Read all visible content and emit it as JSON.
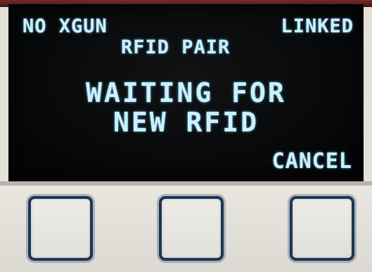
{
  "screen": {
    "status_left": "NO XGUN",
    "status_right": "LINKED",
    "mode_title": "RFID PAIR",
    "message_line1": "WAITING FOR",
    "message_line2": "NEW RFID",
    "softkey_right": "CANCEL"
  },
  "keypad": {
    "keys": [
      "",
      "",
      ""
    ]
  },
  "colors": {
    "display_text": "#c8f2ff",
    "display_background": "#060708",
    "key_border": "#1e3552",
    "panel_background": "#e3e0d8"
  }
}
